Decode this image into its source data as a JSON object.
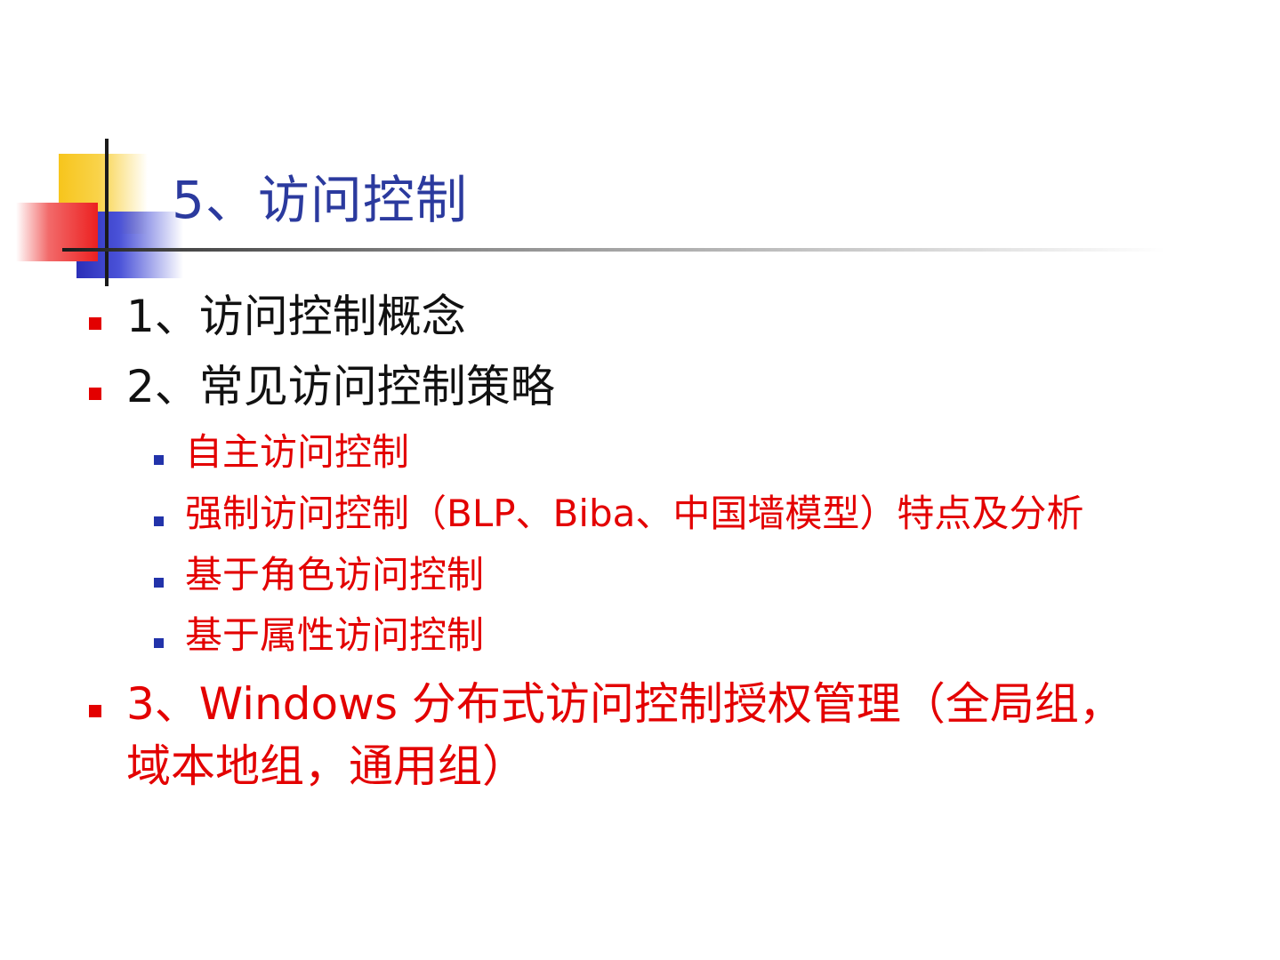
{
  "slide": {
    "title": "5、访问控制",
    "items": [
      {
        "text": "1、访问控制概念",
        "color": "#111111"
      },
      {
        "text": "2、常见访问控制策略",
        "color": "#111111",
        "subitems": [
          "自主访问控制",
          "强制访问控制（BLP、Biba、中国墙模型）特点及分析",
          "基于角色访问控制",
          "基于属性访问控制"
        ]
      },
      {
        "text_line1": "3、Windows 分布式访问控制授权管理（全局组，",
        "text_line2": "域本地组，通用组）",
        "color": "#e30000"
      }
    ],
    "colors": {
      "title": "#2b3a9e",
      "bullet_l1": "#e30000",
      "bullet_l2": "#2233aa",
      "accent_red": "#e30000",
      "accent_yellow": "#f7c51c",
      "accent_blue": "#2b2fb8"
    }
  }
}
